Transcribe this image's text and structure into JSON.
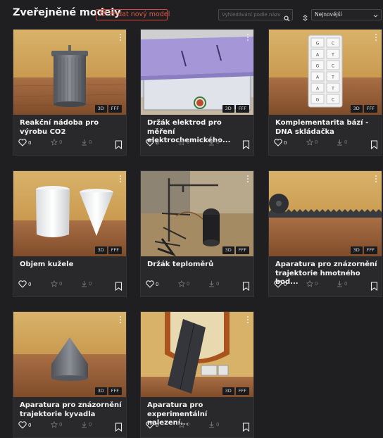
{
  "header": {
    "title": "Zveřejněné modely",
    "add_label": "Přidat nový model",
    "search_placeholder": "Vyhledávání podle názvu",
    "sort_selected": "Nejnovější"
  },
  "badges": [
    "3D",
    "FFF"
  ],
  "cards": [
    {
      "title": "Reakční nádoba pro výrobu CO2",
      "likes": "0",
      "favorites": "0",
      "downloads": "0"
    },
    {
      "title": "Držák elektrod pro měření elektrochemického...",
      "likes": "0",
      "favorites": "0",
      "downloads": "0"
    },
    {
      "title": "Komplementarita bází - DNA skládačka",
      "likes": "0",
      "favorites": "0",
      "downloads": "0"
    },
    {
      "title": "Objem kužele",
      "likes": "0",
      "favorites": "0",
      "downloads": "0"
    },
    {
      "title": "Držák teploměrů",
      "likes": "0",
      "favorites": "0",
      "downloads": "0"
    },
    {
      "title": "Aparatura pro znázornění trajektorie hmotného bod...",
      "likes": "0",
      "favorites": "0",
      "downloads": "0"
    },
    {
      "title": "Aparatura pro znázornění trajektorie kyvadla",
      "likes": "0",
      "favorites": "0",
      "downloads": "0"
    },
    {
      "title": "Aparatura pro experimentální nalezení...",
      "likes": "0",
      "favorites": "0",
      "downloads": "0"
    }
  ],
  "dna_letters": [
    "G",
    "C",
    "A",
    "T",
    "G",
    "C",
    "A",
    "T",
    "A",
    "T",
    "G",
    "C"
  ],
  "colors": {
    "accent": "#d6473b",
    "background": "#1f1f21",
    "card": "#29292c"
  }
}
